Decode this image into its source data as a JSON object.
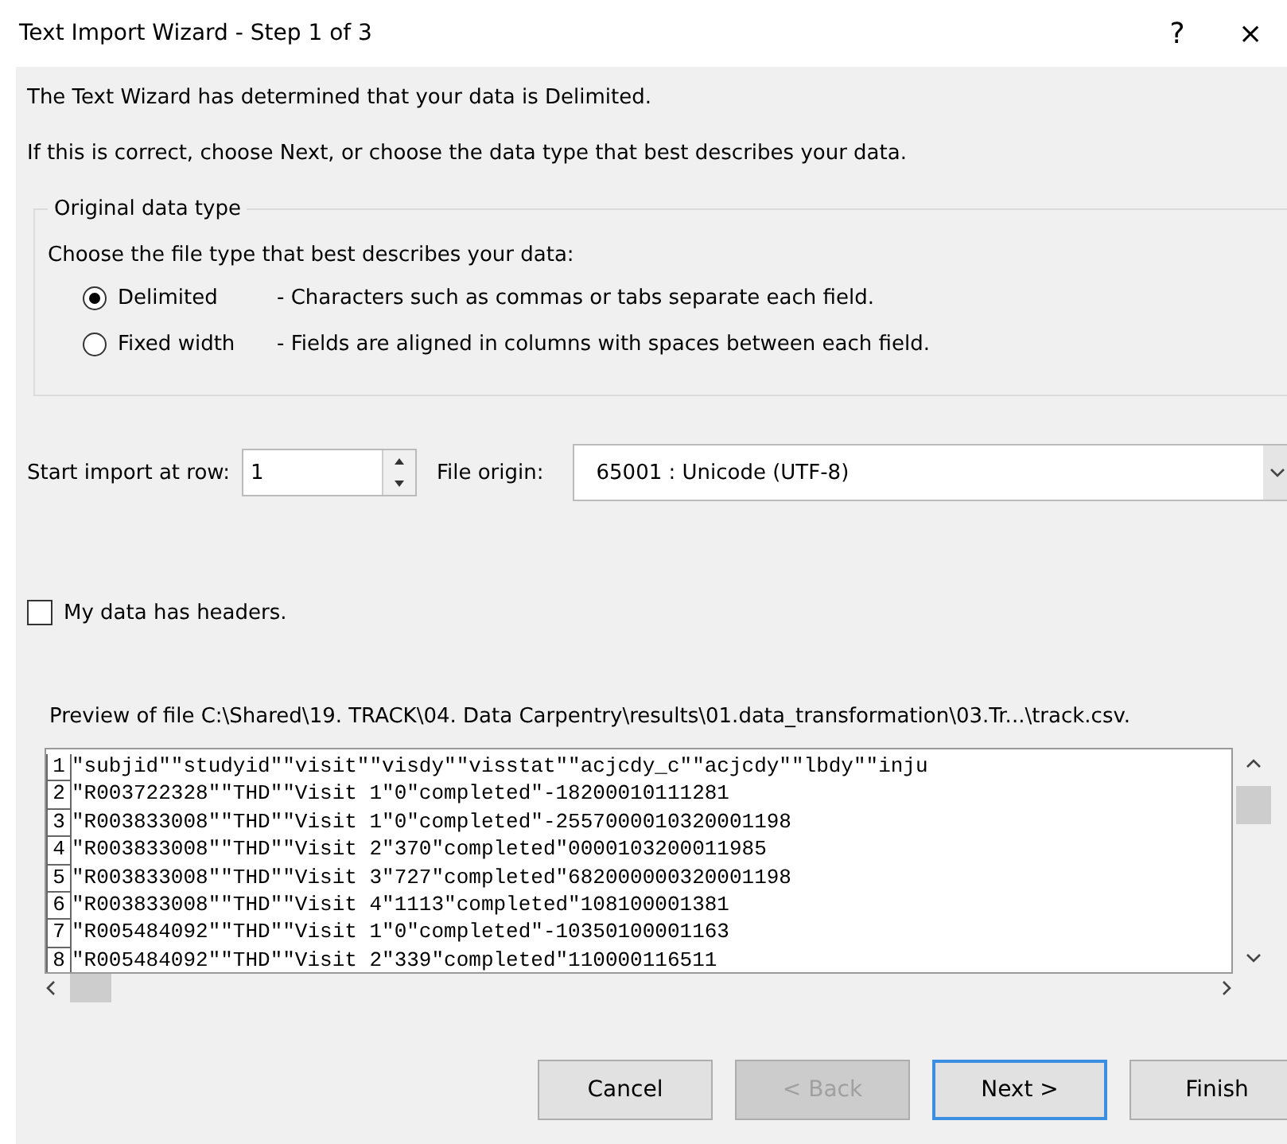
{
  "window": {
    "title": "Text Import Wizard - Step 1 of 3",
    "help": "?",
    "close": "×"
  },
  "intro": [
    "The Text Wizard has determined that your data is Delimited.",
    "If this is correct, choose Next, or choose the data type that best describes your data."
  ],
  "data_type": {
    "legend": "Original data type",
    "prompt": "Choose the file type that best describes your data:",
    "options": [
      {
        "label": "Delimited",
        "description": "- Characters such as commas or tabs separate each field.",
        "selected": true
      },
      {
        "label": "Fixed width",
        "description": "- Fields are aligned in columns with spaces between each field.",
        "selected": false
      }
    ]
  },
  "start_row": {
    "label": "Start import at row:",
    "value": "1"
  },
  "file_origin": {
    "label": "File origin:",
    "value": "65001 : Unicode (UTF-8)"
  },
  "headers": {
    "label": "My data has headers.",
    "checked": false
  },
  "preview": {
    "label": "Preview of file C:\\Shared\\19. TRACK\\04. Data Carpentry\\results\\01.data_transformation\\03.Tr...\\track.csv.",
    "lines": [
      {
        "number": "1",
        "text": "\"subjid\"\"studyid\"\"visit\"\"visdy\"\"visstat\"\"acjcdy_c\"\"acjcdy\"\"lbdy\"\"inju"
      },
      {
        "number": "2",
        "text": "\"R003722328\"\"THD\"\"Visit 1\"0\"completed\"-18200010111281"
      },
      {
        "number": "3",
        "text": "\"R003833008\"\"THD\"\"Visit 1\"0\"completed\"-2557000010320001198"
      },
      {
        "number": "4",
        "text": "\"R003833008\"\"THD\"\"Visit 2\"370\"completed\"0000103200011985"
      },
      {
        "number": "5",
        "text": "\"R003833008\"\"THD\"\"Visit 3\"727\"completed\"682000000320001198"
      },
      {
        "number": "6",
        "text": "\"R003833008\"\"THD\"\"Visit 4\"1113\"completed\"108100001381"
      },
      {
        "number": "7",
        "text": "\"R005484092\"\"THD\"\"Visit 1\"0\"completed\"-10350100001163"
      },
      {
        "number": "8",
        "text": "\"R005484092\"\"THD\"\"Visit 2\"339\"completed\"110000116511"
      }
    ]
  },
  "buttons": [
    {
      "label": "Cancel",
      "disabled": false,
      "default": false
    },
    {
      "label": "< Back",
      "disabled": true,
      "default": false
    },
    {
      "label": "Next >",
      "disabled": false,
      "default": true
    },
    {
      "label": "Finish",
      "disabled": false,
      "default": false
    }
  ]
}
